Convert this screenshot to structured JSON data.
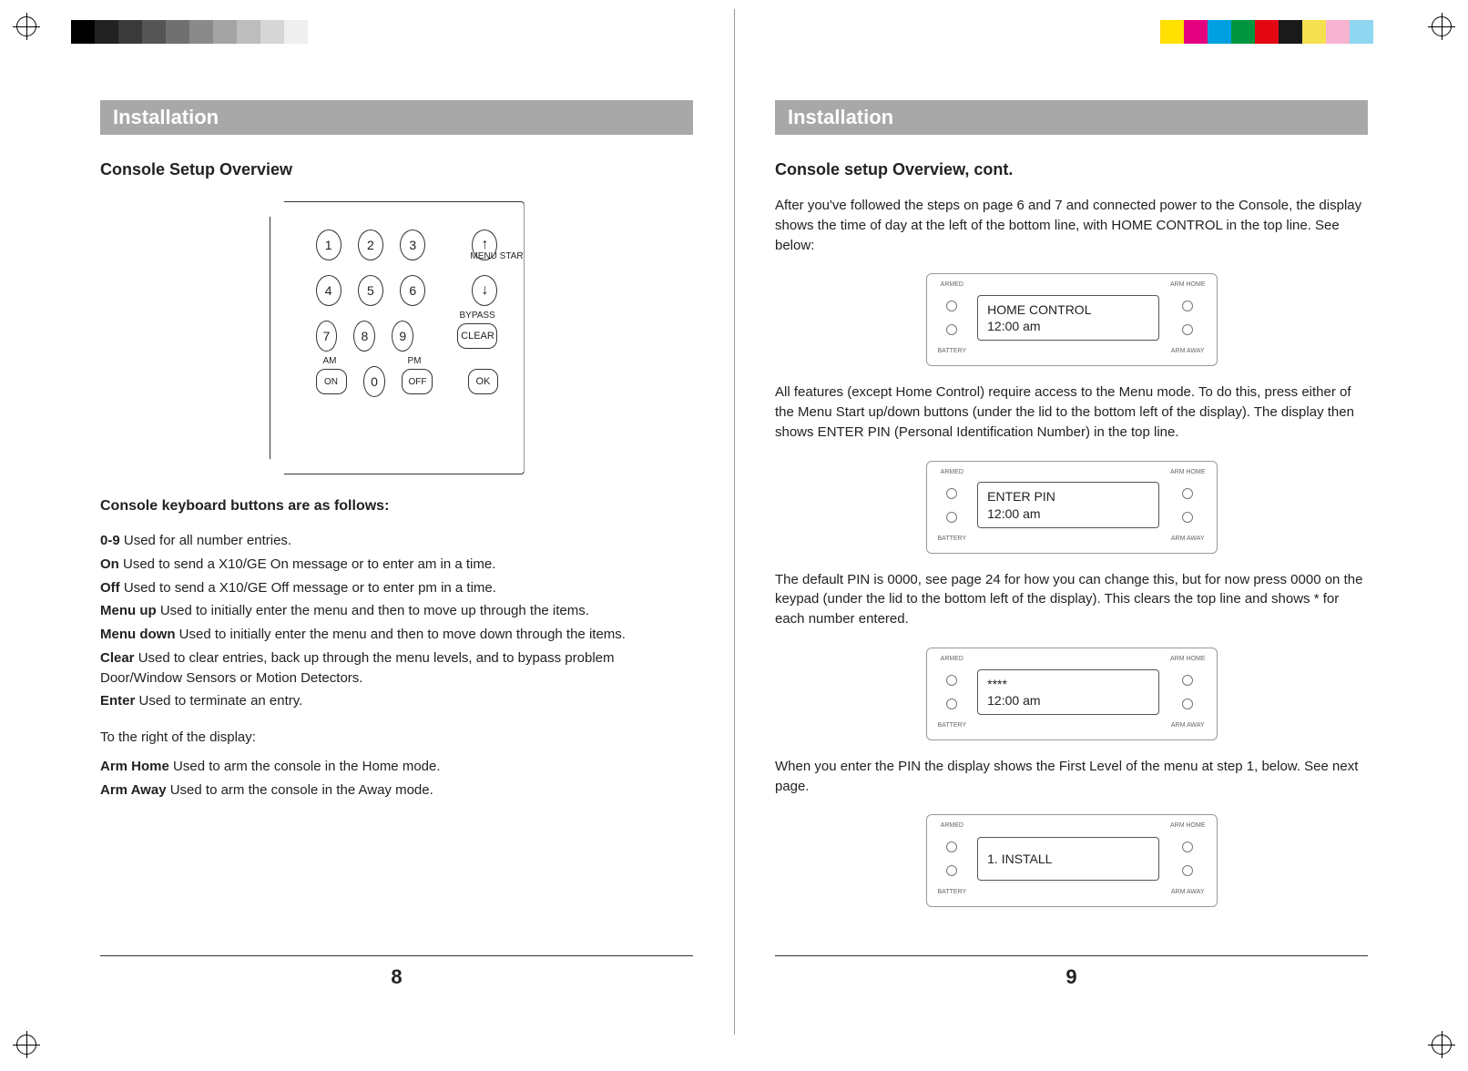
{
  "left": {
    "section": "Installation",
    "heading": "Console Setup Overview",
    "keypad": {
      "rows": [
        [
          "1",
          "2",
          "3"
        ],
        [
          "4",
          "5",
          "6"
        ],
        [
          "7",
          "8",
          "9"
        ]
      ],
      "menu_start_label": "MENU START",
      "bypass_label": "BYPASS",
      "clear_label": "CLEAR",
      "am_label": "AM",
      "pm_label": "PM",
      "on_label": "ON",
      "zero": "0",
      "off_label": "OFF",
      "ok_label": "OK"
    },
    "kb_heading": "Console keyboard buttons are as follows:",
    "kb_items": [
      {
        "term": "0-9",
        "desc": " Used for all number entries."
      },
      {
        "term": "On",
        "desc": " Used to send a X10/GE On message or to enter am in a time."
      },
      {
        "term": "Off",
        "desc": " Used to send a X10/GE Off message or to enter pm in a time."
      },
      {
        "term": "Menu up",
        "desc": " Used to initially enter the menu and then to move up through the items."
      },
      {
        "term": "Menu down",
        "desc": " Used to initially enter the menu and then to move down through the items."
      },
      {
        "term": "Clear",
        "desc": " Used to clear entries, back up through the menu levels, and to bypass problem Door/Window Sensors or Motion Detectors."
      },
      {
        "term": "Enter",
        "desc": " Used to terminate an entry."
      }
    ],
    "right_of_display_label": "To the right of the display:",
    "right_items": [
      {
        "term": "Arm Home",
        "desc": " Used to arm the console in the Home mode."
      },
      {
        "term": "Arm Away",
        "desc": " Used to arm the console in the Away mode."
      }
    ],
    "pagenum": "8"
  },
  "right": {
    "section": "Installation",
    "heading": "Console setup Overview, cont.",
    "para1": "After you've followed the steps on page 6 and 7 and connected power to the Console, the display shows the time of day at the left of the bottom line, with HOME CONTROL in the top line. See below:",
    "lcd1": {
      "line1": "HOME CONTROL",
      "line2": "12:00 am"
    },
    "para2": "All features (except Home Control) require access to the Menu mode. To do this, press either of the Menu Start up/down buttons (under the lid to the bottom left of the display). The display then shows ENTER PIN (Personal Identification Number) in the top line.",
    "lcd2": {
      "line1": "ENTER PIN",
      "line2": "12:00 am"
    },
    "para3": "The default PIN is 0000, see page 24 for how you can change this, but for now press 0000 on the keypad (under the lid to the bottom left of the display). This clears the top line and shows * for each number entered.",
    "lcd3": {
      "line1": "****",
      "line2": "12:00 am"
    },
    "para4": "When you enter the PIN the display shows the First Level of the menu at step 1, below. See next page.",
    "lcd4": {
      "line1": "1. INSTALL",
      "line2": ""
    },
    "side_labels": {
      "armed": "ARMED",
      "battery": "BATTERY",
      "arm_home": "ARM HOME",
      "arm_away": "ARM AWAY"
    },
    "pagenum": "9"
  },
  "colorbar_left": [
    "#000",
    "#222",
    "#3a3a3a",
    "#555",
    "#707070",
    "#8a8a8a",
    "#a4a4a4",
    "#bdbdbd",
    "#d6d6d6",
    "#efefef"
  ],
  "colorbar_right": [
    "#ffe000",
    "#e4007f",
    "#00a0e0",
    "#009640",
    "#e30613",
    "#1a1a1a",
    "#f5e050",
    "#f7b4d0",
    "#8fd6f0",
    "#ffffff"
  ]
}
